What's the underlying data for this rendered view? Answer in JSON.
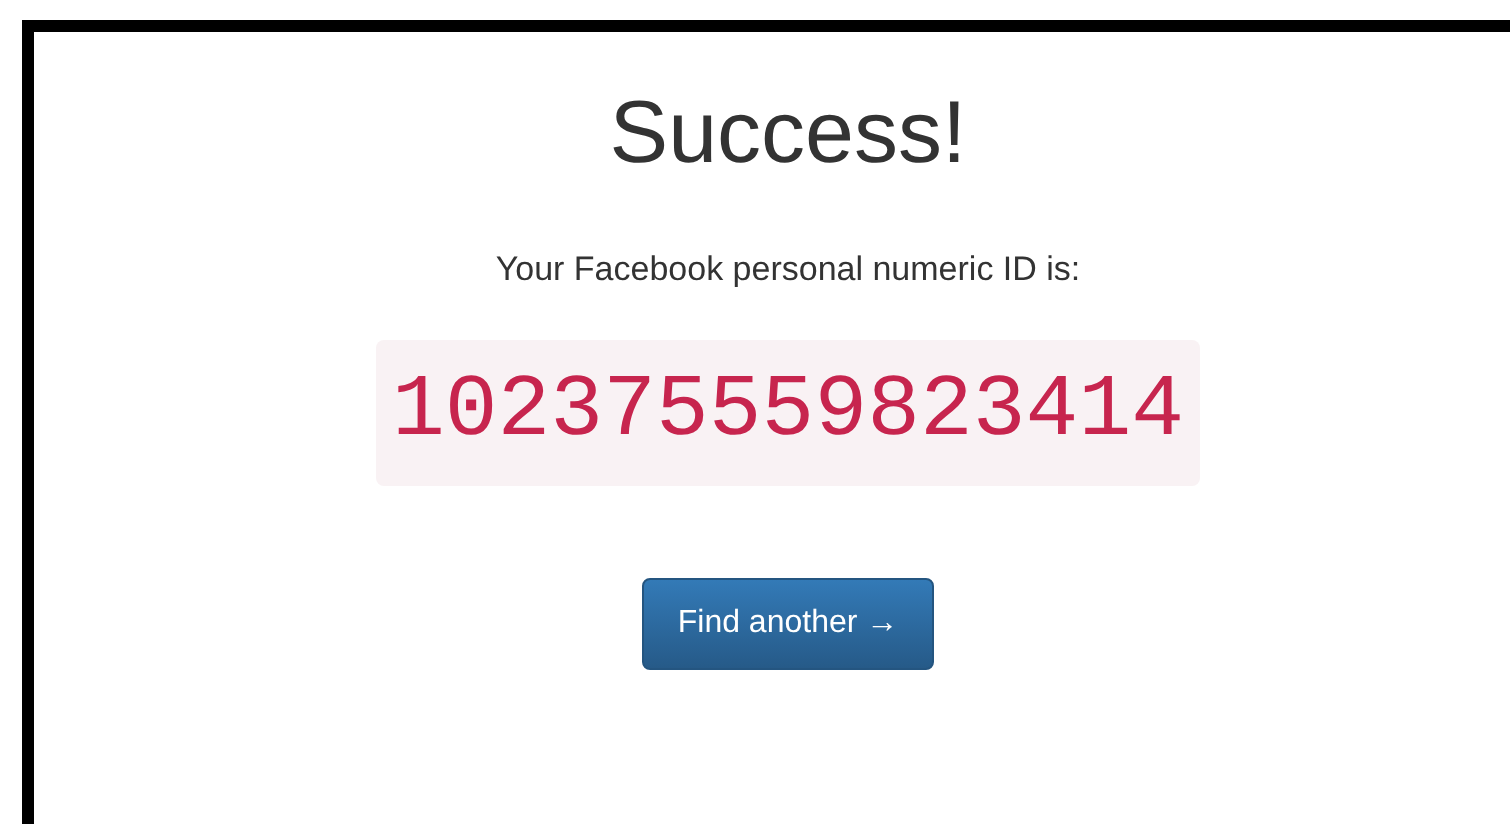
{
  "heading": "Success!",
  "message": "Your Facebook personal numeric ID is:",
  "numeric_id": "102375559823414",
  "button": {
    "label": "Find another →"
  }
}
